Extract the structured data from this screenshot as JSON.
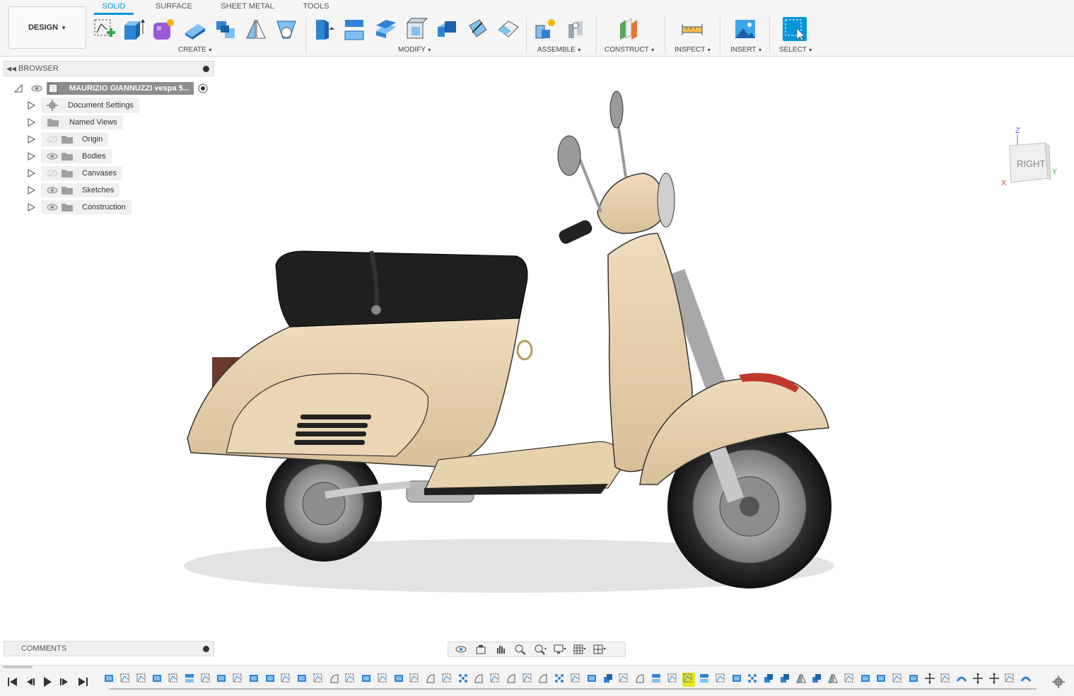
{
  "toolbar": {
    "workspace": "DESIGN",
    "tabs": [
      "SOLID",
      "SURFACE",
      "SHEET METAL",
      "TOOLS"
    ],
    "active_tab": "SOLID",
    "groups": {
      "create": "CREATE",
      "modify": "MODIFY",
      "assemble": "ASSEMBLE",
      "construct": "CONSTRUCT",
      "inspect": "INSPECT",
      "insert": "INSERT",
      "select": "SELECT"
    }
  },
  "browser": {
    "title": "BROWSER",
    "root": "MAURIZIO GIANNUZZI vespa 5...",
    "items": [
      {
        "label": "Document Settings",
        "icon": "gear-icon"
      },
      {
        "label": "Named Views",
        "icon": "folder-icon"
      },
      {
        "label": "Origin",
        "icon": "folder-icon",
        "visible": false
      },
      {
        "label": "Bodies",
        "icon": "folder-icon",
        "visible": true
      },
      {
        "label": "Canvases",
        "icon": "folder-icon",
        "visible": false
      },
      {
        "label": "Sketches",
        "icon": "folder-icon",
        "visible": true
      },
      {
        "label": "Construction",
        "icon": "folder-icon",
        "visible": true
      }
    ]
  },
  "viewcube": {
    "face": "RIGHT",
    "axis_z": "Z",
    "axis_y": "Y",
    "axis_x": "X"
  },
  "comments": {
    "title": "COMMENTS"
  },
  "colors": {
    "accent": "#0696d7",
    "body": "#e8d3b0",
    "seat": "#1e1e1e",
    "timeline_highlight": "#e5e52a"
  }
}
